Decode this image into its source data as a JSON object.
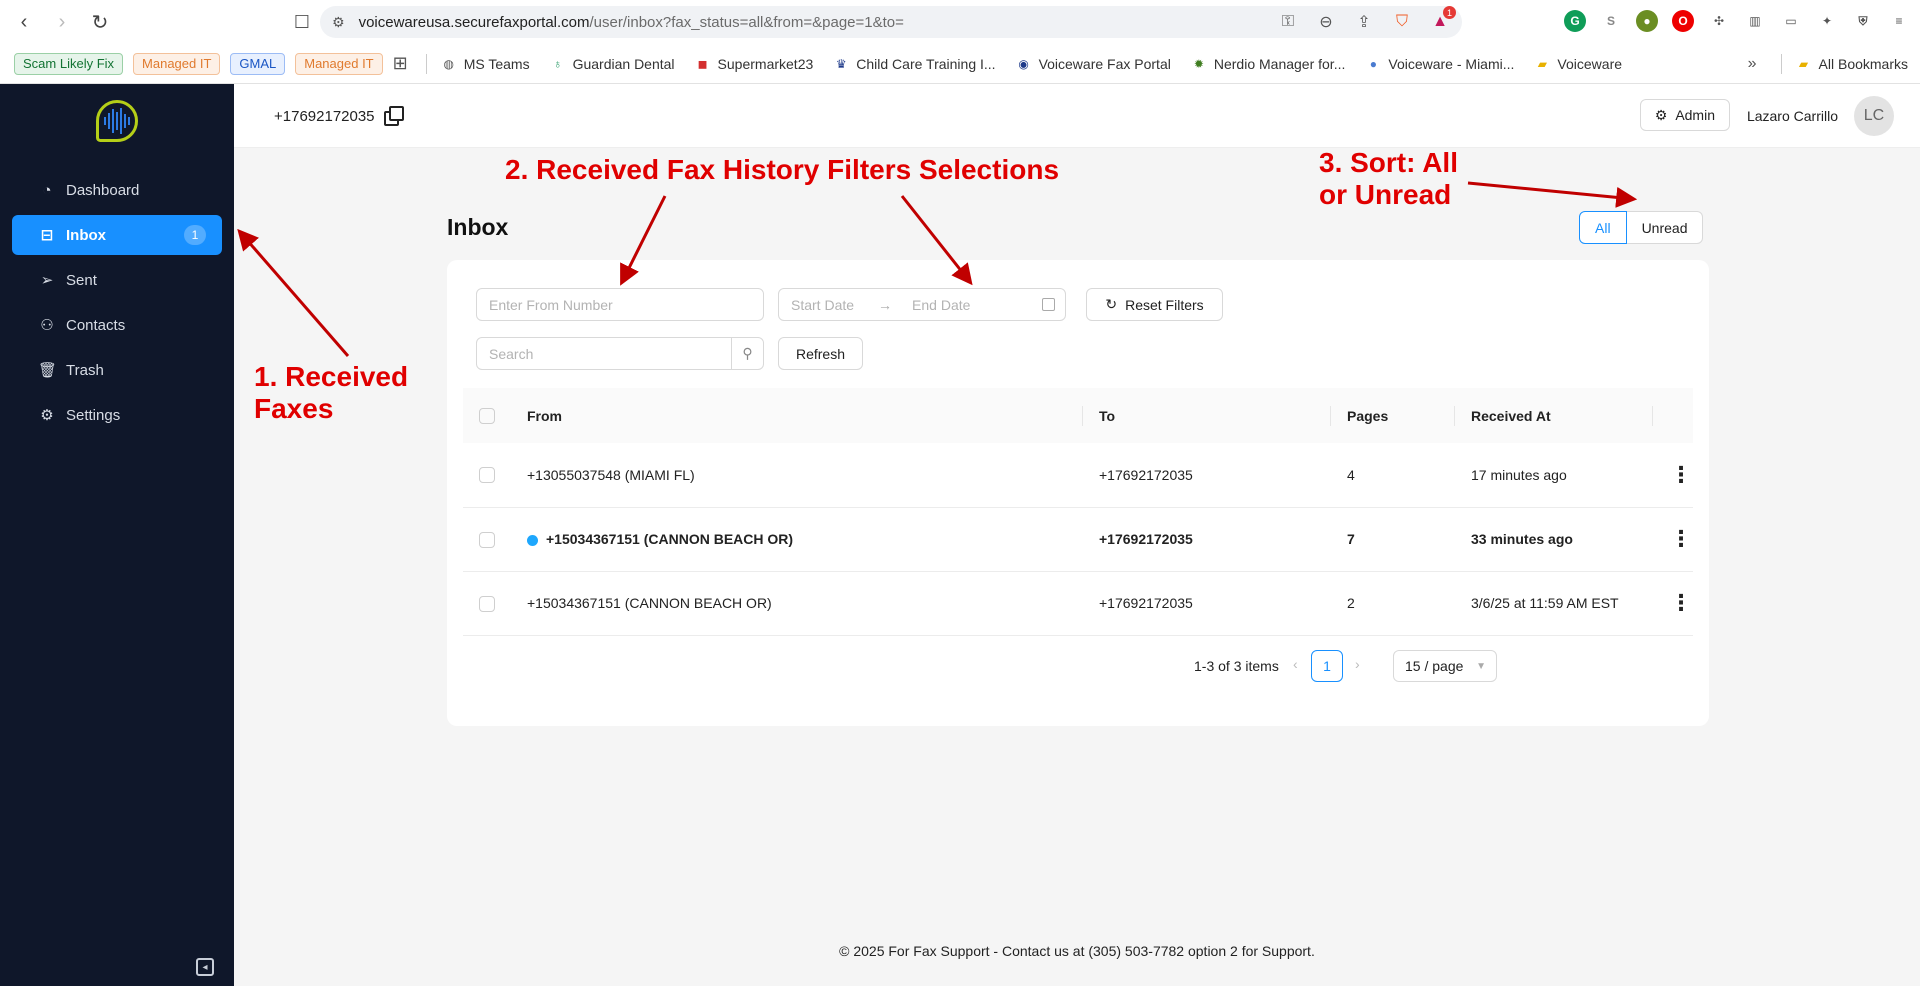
{
  "browser": {
    "url_host": "voicewareusa.securefaxportal.com",
    "url_path": "/user/inbox?fax_status=all&from=&page=1&to=",
    "notification_count": "1",
    "bookmark_chips": [
      {
        "label": "Scam Likely Fix",
        "color": "green"
      },
      {
        "label": "Managed IT",
        "color": "orange"
      },
      {
        "label": "GMAL",
        "color": "blue"
      },
      {
        "label": "Managed IT",
        "color": "orange"
      }
    ],
    "bookmarks": [
      {
        "label": "MS Teams",
        "icon": "globe-icon"
      },
      {
        "label": "Guardian Dental",
        "icon": "tooth-icon"
      },
      {
        "label": "Supermarket23",
        "icon": "store-icon"
      },
      {
        "label": "Child Care Training I...",
        "icon": "school-icon"
      },
      {
        "label": "Voiceware Fax Portal",
        "icon": "fax-icon"
      },
      {
        "label": "Nerdio Manager for...",
        "icon": "nerdio-icon"
      },
      {
        "label": "Voiceware - Miami...",
        "icon": "person-icon"
      },
      {
        "label": "Voiceware",
        "icon": "folder-icon"
      }
    ],
    "all_bookmarks_label": "All Bookmarks",
    "overflow_label": "»"
  },
  "app": {
    "fax_number": "+17692172035",
    "admin_label": "Admin",
    "user_name": "Lazaro Carrillo",
    "avatar_initials": "LC",
    "accent_color": "#1890ff",
    "sidebar_bg": "#0f172a"
  },
  "sidebar": {
    "items": [
      {
        "label": "Dashboard",
        "icon": "dashboard-icon",
        "badge": ""
      },
      {
        "label": "Inbox",
        "icon": "inbox-icon",
        "badge": "1"
      },
      {
        "label": "Sent",
        "icon": "send-icon",
        "badge": ""
      },
      {
        "label": "Contacts",
        "icon": "contacts-icon",
        "badge": ""
      },
      {
        "label": "Trash",
        "icon": "trash-icon",
        "badge": ""
      },
      {
        "label": "Settings",
        "icon": "gear-icon",
        "badge": ""
      }
    ],
    "active": "Inbox"
  },
  "inbox": {
    "title": "Inbox",
    "segment": {
      "all_label": "All",
      "unread_label": "Unread",
      "selected": "All"
    },
    "filters": {
      "from_placeholder": "Enter From Number",
      "start_placeholder": "Start Date",
      "end_placeholder": "End Date",
      "reset_label": "Reset Filters",
      "search_placeholder": "Search",
      "refresh_label": "Refresh"
    },
    "columns": {
      "from": "From",
      "to": "To",
      "pages": "Pages",
      "received": "Received At"
    },
    "rows": [
      {
        "from": "+13055037548 (MIAMI FL)",
        "to": "+17692172035",
        "pages": "4",
        "received": "17 minutes ago",
        "unread": false
      },
      {
        "from": "+15034367151 (CANNON BEACH OR)",
        "to": "+17692172035",
        "pages": "7",
        "received": "33 minutes ago",
        "unread": true
      },
      {
        "from": "+15034367151 (CANNON BEACH OR)",
        "to": "+17692172035",
        "pages": "2",
        "received": "3/6/25 at 11:59 AM EST",
        "unread": false
      }
    ],
    "pagination": {
      "summary": "1-3 of 3 items",
      "current_page": "1",
      "page_size": "15 / page"
    }
  },
  "footer": {
    "text": "© 2025 For Fax Support - Contact us at (305) 503-7782 option 2 for Support."
  },
  "annotations": {
    "one_line1": "1. Received",
    "one_line2": "Faxes",
    "two": "2. Received Fax History Filters Selections",
    "three_line1": "3. Sort: All",
    "three_line2": "or Unread",
    "color": "#e00000"
  }
}
